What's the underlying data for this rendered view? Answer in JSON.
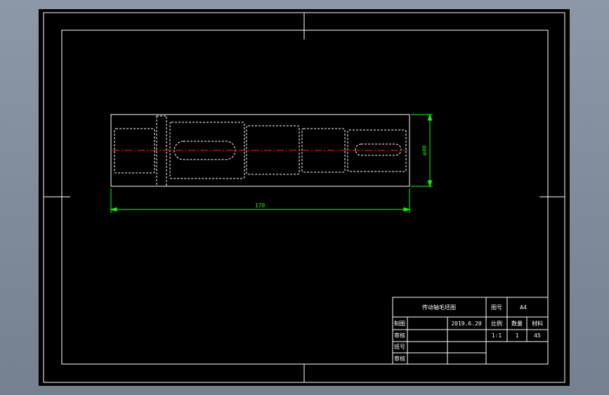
{
  "drawing": {
    "background": "#000000",
    "line_color": "#ffffff",
    "dim_color": "#00ff00",
    "center_color": "#ff2020"
  },
  "dimensions": {
    "length_label": "170",
    "diameter_label": "ø40"
  },
  "title_block": {
    "part_name": "传动轴毛坯图",
    "drawing_no_label": "图号",
    "drawing_no_value": "A4",
    "draw_label": "制图",
    "date": "2019.6.20",
    "check_label": "审核",
    "scale_label": "比例",
    "quantity_label": "数量",
    "material_label": "材料",
    "scale_value": "1:1",
    "quantity_value": "1",
    "material_value": "45",
    "class_label": "班号",
    "approve_label": "审核"
  }
}
